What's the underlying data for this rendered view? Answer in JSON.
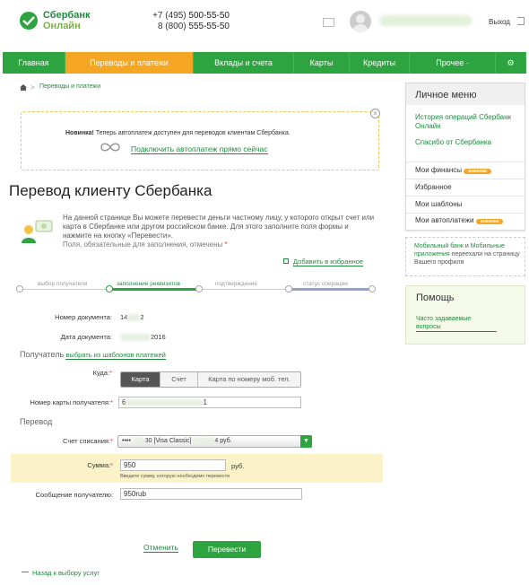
{
  "header": {
    "logo_line1": "Сбербанк",
    "logo_line2": "Онлайн",
    "phone1_prefix": "+7 (495) ",
    "phone1_number": "500-55-50",
    "phone2_prefix": "8 (800) ",
    "phone2_number": "555-55-50",
    "logout": "Выход"
  },
  "nav": [
    {
      "label": "Главная",
      "width": 70
    },
    {
      "label": "Переводы и платежи",
      "width": 143,
      "active": true
    },
    {
      "label": "Вклады и счета",
      "width": 112
    },
    {
      "label": "Карты",
      "width": 62
    },
    {
      "label": "Кредиты",
      "width": 67
    },
    {
      "label": "Прочее ·",
      "width": 96
    },
    {
      "label": "⚙",
      "width": 34
    }
  ],
  "breadcrumb": {
    "sep": ">",
    "link": "Переводы и платежи"
  },
  "notice": {
    "bold": "Новинка!",
    "text": " Теперь автоплатеж доступен для переводов клиентам Сбербанка.",
    "link": "Подключить автоплатеж прямо сейчас"
  },
  "title": "Перевод клиенту Сбербанка",
  "intro": {
    "text": "На данной странице Вы можете перевести деньги частному лицу, у которого открыт счет или карта в Сбербанке или другом российском банке. Для этого заполните поля формы и нажмите на кнопку «Перевести».",
    "required": "Поля, обязательные для заполнения, отмечены ",
    "star": "*",
    "fav": "Добавить в избранное"
  },
  "steps": [
    "выбор получателя",
    "заполнение реквизитов",
    "подтверждение",
    "статус операции"
  ],
  "doc": {
    "num_label": "Номер документа:",
    "num_a": "14",
    "num_b": "2",
    "date_label": "Дата документа:",
    "date_tail": "2016"
  },
  "recipient": {
    "heading": "Получатель",
    "link": "выбрать из шаблонов платежей",
    "where_label": "Куда:",
    "where_star": "*",
    "options": [
      "Карта",
      "Счет",
      "Карта по номеру моб. тел."
    ],
    "card_label": "Номер карты получателя:",
    "card_star": "*",
    "card_a": "6",
    "card_b": "1"
  },
  "transfer": {
    "heading": "Перевод",
    "source_label": "Счет списания:",
    "source_star": "*",
    "source_a": "••••",
    "source_b": "30",
    "source_c": "[Visa Classic]",
    "source_d": "4",
    "source_e": "руб.",
    "sum_label": "Сумма:",
    "sum_star": "*",
    "sum_value": "950",
    "sum_currency": "руб.",
    "sum_hint": "Введите сумму, которую необходимо перевести",
    "msg_label": "Сообщение получателю:",
    "msg_value": "950rub"
  },
  "actions": {
    "cancel": "Отменить",
    "submit": "Перевести",
    "back": "Назад к выбору услуг"
  },
  "sidebar": {
    "title": "Личное меню",
    "links": [
      "История операций Сбербанк Онлайн",
      "Спасибо от Сбербанка"
    ],
    "items": [
      {
        "label": "Мои финансы",
        "badge": "новинка"
      },
      {
        "label": "Избранное"
      },
      {
        "label": "Мои шаблоны"
      },
      {
        "label": "Мои автоплатежи",
        "badge": "новинка"
      }
    ],
    "mobile_link1": "Мобильный банк",
    "mobile_and": " и ",
    "mobile_link2": "Мобильные приложения",
    "mobile_rest": " переехали на страницу Вашего профиля",
    "help_title": "Помощь",
    "help_link": "Часто задаваемые вопросы"
  },
  "colors": {
    "brand": "#2da43f",
    "active_tab": "#f5a623",
    "highlight": "#fbf3c7"
  }
}
